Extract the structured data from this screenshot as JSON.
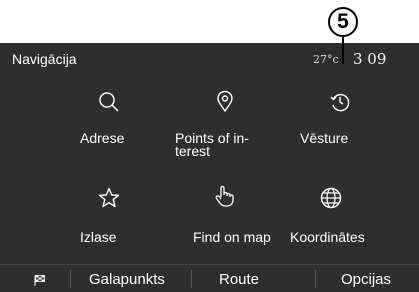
{
  "callout": {
    "number": "5"
  },
  "header": {
    "title": "Navigācija",
    "temperature": "27°c",
    "time": "3 09"
  },
  "menu": [
    {
      "label": "Adrese",
      "icon": "search-icon"
    },
    {
      "label": "Points of in-terest",
      "label_line1": "Points of in-",
      "label_line2": "terest",
      "icon": "location-pin-icon"
    },
    {
      "label": "Vēsture",
      "icon": "history-icon"
    },
    {
      "label": "Izlase",
      "icon": "star-icon"
    },
    {
      "label": "Find on map",
      "icon": "hand-pointer-icon"
    },
    {
      "label": "Koordinātes",
      "icon": "globe-icon"
    }
  ],
  "tabs": {
    "destination": "Galapunkts",
    "route": "Route",
    "options": "Opcijas",
    "flag_icon": "flag-icon"
  }
}
